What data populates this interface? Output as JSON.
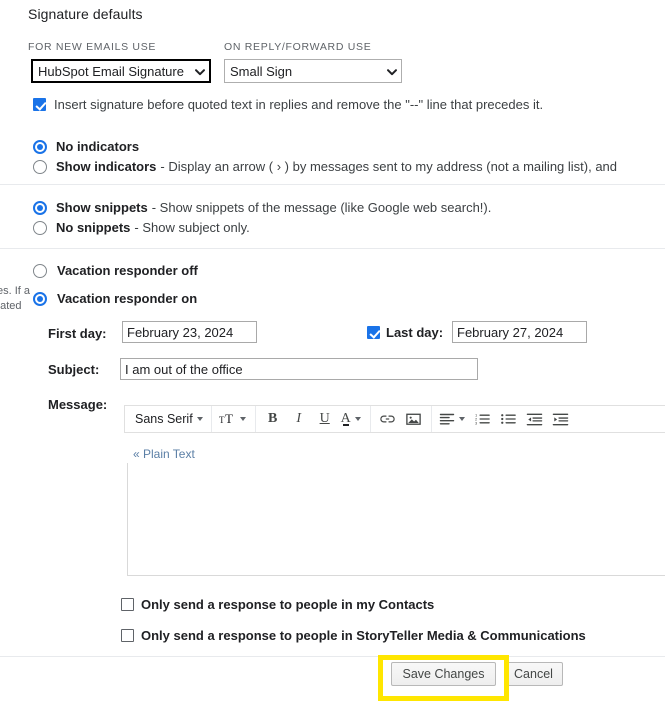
{
  "section": {
    "title": "Signature defaults"
  },
  "signature_defaults": {
    "new_emails_label": "FOR NEW EMAILS USE",
    "new_emails_value": "HubSpot Email Signature",
    "reply_forward_label": "ON REPLY/FORWARD USE",
    "reply_forward_value": "Small Sign",
    "insert_signature": {
      "checked": true,
      "label": "Insert signature before quoted text in replies and remove the \"--\" line that precedes it."
    }
  },
  "indicators": {
    "options": [
      {
        "label": "No indicators",
        "description": "",
        "selected": true
      },
      {
        "label": "Show indicators",
        "description": "- Display an arrow ( › ) by messages sent to my address (not a mailing list), and",
        "selected": false
      }
    ]
  },
  "snippets": {
    "options": [
      {
        "label": "Show snippets",
        "description": "- Show snippets of the message (like Google web search!).",
        "selected": true
      },
      {
        "label": "No snippets",
        "description": "- Show subject only.",
        "selected": false
      }
    ]
  },
  "clipped_side_text": {
    "line1": "es. If a",
    "line2": "nated"
  },
  "vacation_responder": {
    "off_label": "Vacation responder off",
    "on_label": "Vacation responder on",
    "off_selected": false,
    "on_selected": true,
    "first_day_label": "First day:",
    "first_day_value": "February 23, 2024",
    "last_day_label": "Last day:",
    "last_day_value": "February 27, 2024",
    "last_day_checked": true,
    "subject_label": "Subject:",
    "subject_value": "I am out of the office",
    "message_label": "Message:",
    "message_value": "",
    "plain_text_link": "« Plain Text",
    "toolbar": {
      "font_family": "Sans Serif",
      "items": [
        {
          "name": "font-family-dropdown",
          "glyph": "Sans Serif"
        },
        {
          "name": "font-size-button",
          "glyph": "ᴛT"
        },
        {
          "name": "bold-button",
          "glyph": "B"
        },
        {
          "name": "italic-button",
          "glyph": "I"
        },
        {
          "name": "underline-button",
          "glyph": "U"
        },
        {
          "name": "text-color-button",
          "glyph": "A"
        },
        {
          "name": "insert-link-button",
          "glyph": "link"
        },
        {
          "name": "insert-image-button",
          "glyph": "image"
        },
        {
          "name": "align-button",
          "glyph": "align"
        },
        {
          "name": "numbered-list-button",
          "glyph": "ol"
        },
        {
          "name": "bulleted-list-button",
          "glyph": "ul"
        },
        {
          "name": "indent-less-button",
          "glyph": "outdent"
        },
        {
          "name": "indent-more-button",
          "glyph": "indent"
        }
      ]
    },
    "contacts_only": {
      "checked": false,
      "label": "Only send a response to people in my Contacts"
    },
    "org_only": {
      "checked": false,
      "label": "Only send a response to people in StoryTeller Media & Communications"
    }
  },
  "footer": {
    "save_label": "Save Changes",
    "cancel_label": "Cancel"
  },
  "colors": {
    "accent_blue": "#1a73e8",
    "annotation_yellow": "#ffe600",
    "text_primary": "#202124",
    "text_secondary": "#5f6368"
  }
}
